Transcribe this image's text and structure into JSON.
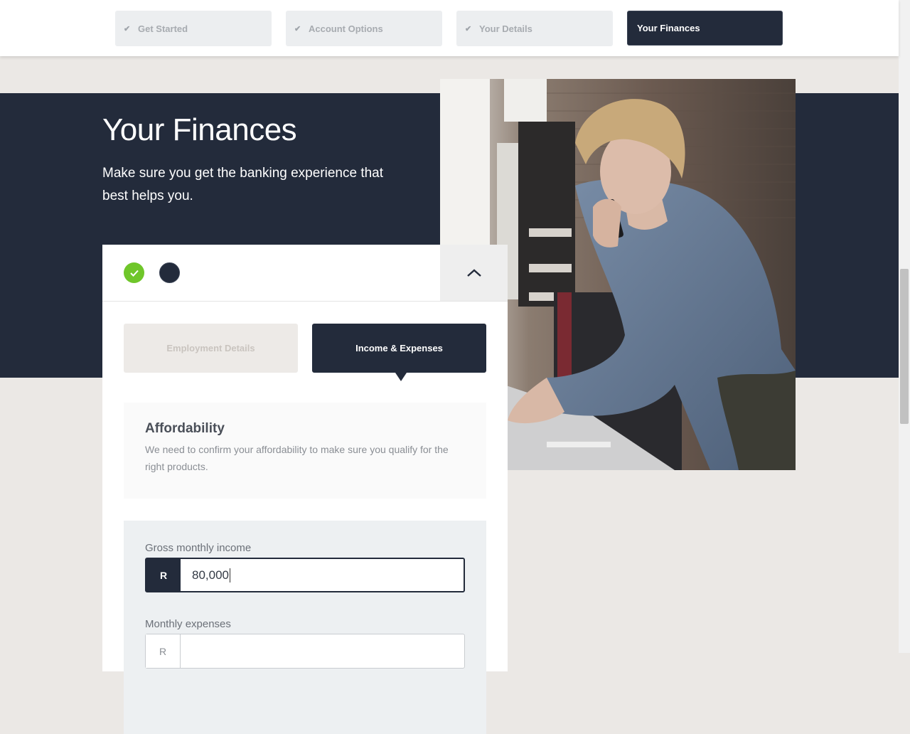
{
  "steps": [
    {
      "label": "Get Started",
      "state": "done"
    },
    {
      "label": "Account Options",
      "state": "done"
    },
    {
      "label": "Your Details",
      "state": "done"
    },
    {
      "label": "Your Finances",
      "state": "active"
    }
  ],
  "hero": {
    "title": "Your Finances",
    "subtitle": "Make sure you get the banking experience that best helps you."
  },
  "card": {
    "progress_icons": [
      "check-circle-icon",
      "current-step-dot-icon"
    ],
    "collapse_icon": "chevron-up-icon",
    "tabs": [
      {
        "label": "Employment Details",
        "active": false
      },
      {
        "label": "Income & Expenses",
        "active": true
      }
    ],
    "info": {
      "heading": "Affordability",
      "text": "We need to confirm your affordability to make sure you qualify for the right products."
    },
    "fields": [
      {
        "label": "Gross monthly income",
        "prefix": "R",
        "value": "80,000"
      },
      {
        "label": "Monthly expenses",
        "prefix": "R",
        "value": ""
      }
    ]
  },
  "colors": {
    "navy": "#232b3b",
    "success_green": "#6fc62a",
    "page_bg": "#ebe8e5"
  }
}
